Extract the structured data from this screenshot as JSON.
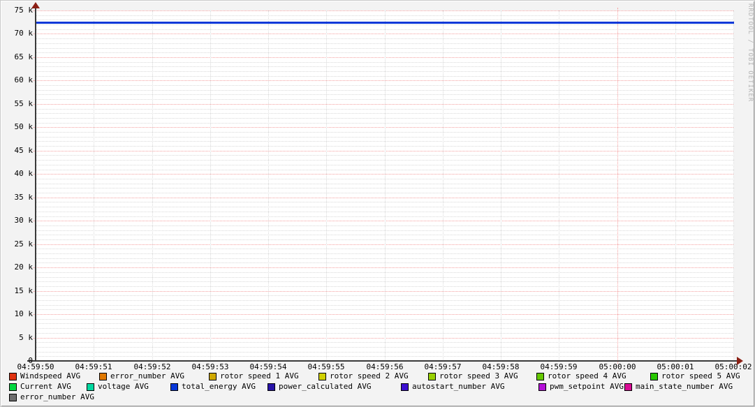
{
  "watermark": "RRDTOOL / TOBI OETIKER",
  "chart_data": {
    "type": "line",
    "title": "",
    "xlabel": "",
    "ylabel": "",
    "x_tick_labels": [
      "04:59:50",
      "04:59:51",
      "04:59:52",
      "04:59:53",
      "04:59:54",
      "04:59:55",
      "04:59:56",
      "04:59:57",
      "04:59:58",
      "04:59:59",
      "05:00:00",
      "05:00:01",
      "05:00:02"
    ],
    "x_major_tick_labels": [
      "05:00:00"
    ],
    "y_tick_values": [
      0,
      5000,
      10000,
      15000,
      20000,
      25000,
      30000,
      35000,
      40000,
      45000,
      50000,
      55000,
      60000,
      65000,
      70000,
      75000
    ],
    "y_tick_labels": [
      "0",
      "5 k",
      "10 k",
      "15 k",
      "20 k",
      "25 k",
      "30 k",
      "35 k",
      "40 k",
      "45 k",
      "50 k",
      "55 k",
      "60 k",
      "65 k",
      "70 k",
      "75 k"
    ],
    "ylim": [
      0,
      75000
    ],
    "y_minor_step": 1000,
    "y_major_step": 5000,
    "grid": {
      "on": true,
      "major_color": "#f5a0a0",
      "minor_color": "#d9d9d9"
    },
    "legend_position": "bottom",
    "series": [
      {
        "name": "total_energy AVG",
        "color": "#0838d8",
        "x": [
          "04:59:50",
          "05:00:02"
        ],
        "values": [
          72500,
          72500
        ],
        "note": "constant horizontal line at ~72.5k across full x-range"
      }
    ]
  },
  "legend": {
    "rows": [
      [
        {
          "label": "Windspeed AVG",
          "color": "#e03210"
        },
        {
          "label": "error_number AVG",
          "color": "#e07800"
        },
        {
          "label": "rotor speed 1 AVG",
          "color": "#cfa800"
        },
        {
          "label": "rotor speed 2 AVG",
          "color": "#d0d000"
        },
        {
          "label": "rotor speed 3 AVG",
          "color": "#98d000"
        },
        {
          "label": "rotor speed 4 AVG",
          "color": "#64c800"
        },
        {
          "label": "rotor speed 5 AVG",
          "color": "#28c800"
        }
      ],
      [
        {
          "label": "Current AVG",
          "color": "#00d840"
        },
        {
          "label": "voltage AVG",
          "color": "#00d8a0"
        },
        {
          "label": "total_energy AVG",
          "color": "#0838d8"
        },
        {
          "label": "power_calculated AVG",
          "color": "#2814a8"
        },
        {
          "label": "autostart_number AVG",
          "color": "#3c10d0"
        },
        {
          "label": "pwm_setpoint AVG",
          "color": "#b410d8"
        },
        {
          "label": "main_state_number AVG",
          "color": "#d80c94"
        }
      ],
      [
        {
          "label": "error_number AVG",
          "color": "#6e6e6e"
        }
      ]
    ]
  }
}
